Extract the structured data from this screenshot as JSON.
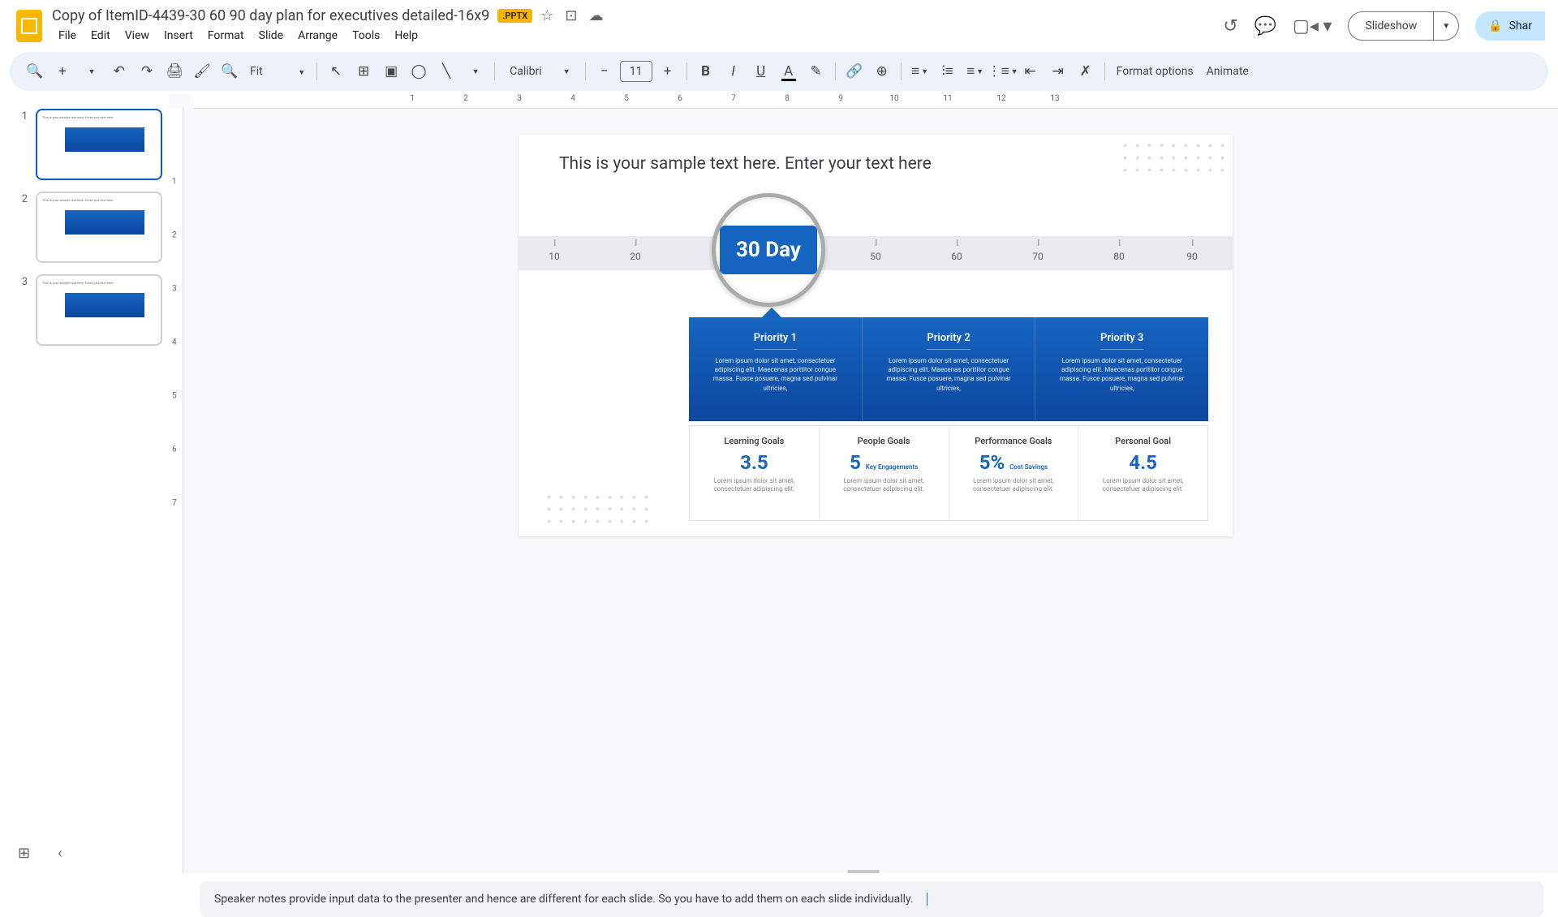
{
  "header": {
    "doc_title": "Copy of ItemID-4439-30 60 90 day plan for executives detailed-16x9",
    "badge": ".PPTX",
    "menus": [
      "File",
      "Edit",
      "View",
      "Insert",
      "Format",
      "Slide",
      "Arrange",
      "Tools",
      "Help"
    ],
    "slideshow": "Slideshow",
    "share": "Shar"
  },
  "toolbar": {
    "zoom": "Fit",
    "font": "Calibri",
    "font_size": "11",
    "format_options": "Format options",
    "animate": "Animate"
  },
  "ruler_h": [
    "1",
    "2",
    "3",
    "4",
    "5",
    "6",
    "7",
    "8",
    "9",
    "10",
    "11",
    "12",
    "13"
  ],
  "ruler_v": [
    "1",
    "2",
    "3",
    "4",
    "5",
    "6",
    "7"
  ],
  "thumbs": [
    "1",
    "2",
    "3"
  ],
  "slide": {
    "title": "This is your sample text here. Enter your text here",
    "timeline": [
      "10",
      "20",
      "",
      "50",
      "60",
      "70",
      "80",
      "90"
    ],
    "magnifier": "30 Day",
    "priorities": [
      {
        "title": "Priority 1",
        "text": "Lorem ipsum dolor sit amet, consectetuer adipiscing elit. Maecenas porttitor congue massa. Fusce posuere, magna sed pulvinar ultricies,"
      },
      {
        "title": "Priority 2",
        "text": "Lorem ipsum dolor sit amet, consectetuer adipiscing elit. Maecenas porttitor congue massa. Fusce posuere, magna sed pulvinar ultricies,"
      },
      {
        "title": "Priority 3",
        "text": "Lorem ipsum dolor sit amet, consectetuer adipiscing elit. Maecenas porttitor congue massa. Fusce posuere, magna sed pulvinar ultricies,"
      }
    ],
    "goals": [
      {
        "title": "Learning Goals",
        "value": "3.5",
        "sub": "",
        "desc": "Lorem ipsum dolor sit amet, consectetuer adipiscing elit."
      },
      {
        "title": "People Goals",
        "value": "5",
        "sub": "Key Engagements",
        "desc": "Lorem ipsum dolor sit amet, consectetuer adipiscing elit."
      },
      {
        "title": "Performance Goals",
        "value": "5%",
        "sub": "Cost Savings",
        "desc": "Lorem ipsum dolor sit amet, consectetuer adipiscing elit."
      },
      {
        "title": "Personal Goal",
        "value": "4.5",
        "sub": "",
        "desc": "Lorem ipsum dolor sit amet, consectetuer adipiscing elit."
      }
    ]
  },
  "notes": "Speaker notes provide input data to the presenter and hence are different for each slide. So you have to add them on each slide individually."
}
